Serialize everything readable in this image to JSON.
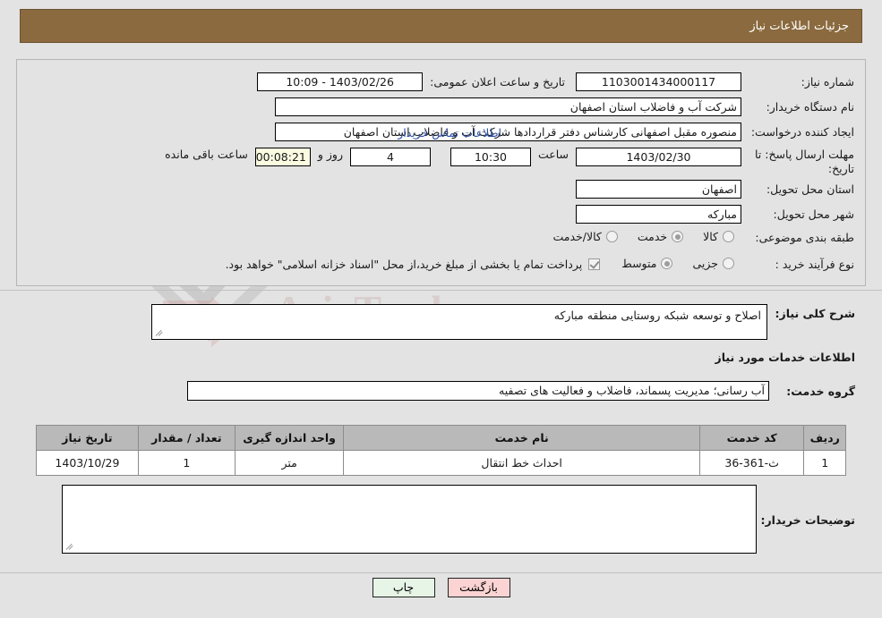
{
  "header": {
    "title": "جزئیات اطلاعات نیاز"
  },
  "top_panel": {
    "need_number_label": "شماره نیاز:",
    "need_number_value": "1103001434000117",
    "announce_label": "تاریخ و ساعت اعلان عمومی:",
    "announce_value": "1403/02/26 - 10:09",
    "buyer_label": "نام دستگاه خریدار:",
    "buyer_value": "شرکت آب و فاضلاب استان اصفهان",
    "creator_label": "ایجاد کننده درخواست:",
    "creator_value": "منصوره مقبل اصفهانی کارشناس دفتر قراردادها شرکت آب و فاضلاب استان اصفهان",
    "contact_link": "اطلاعات تماس خریدار",
    "deadline_label": "مهلت ارسال پاسخ: تا تاریخ:",
    "deadline_date": "1403/02/30",
    "hour_label": "ساعت",
    "deadline_time": "10:30",
    "days_value": "4",
    "days_label": "روز و",
    "remaining_value": "00:08:21",
    "remaining_label": "ساعت باقی مانده",
    "province_label": "استان محل تحویل:",
    "province_value": "اصفهان",
    "city_label": "شهر محل تحویل:",
    "city_value": "مبارکه",
    "category_label": "طبقه بندی موضوعی:",
    "category_options": [
      {
        "label": "کالا",
        "selected": false
      },
      {
        "label": "خدمت",
        "selected": true
      },
      {
        "label": "کالا/خدمت",
        "selected": false
      }
    ],
    "process_label": "نوع فرآیند خرید :",
    "process_options": [
      {
        "label": "جزیی",
        "selected": false
      },
      {
        "label": "متوسط",
        "selected": true
      }
    ],
    "payment_checked": true,
    "payment_note": "پرداخت تمام یا بخشی از مبلغ خرید،از محل \"اسناد خزانه اسلامی\" خواهد بود."
  },
  "mid_panel": {
    "summary_label": "شرح کلی نیاز:",
    "summary_value": "اصلاح و توسعه شبکه روستایی منطقه مبارکه",
    "services_heading": "اطلاعات خدمات مورد نیاز",
    "service_group_label": "گروه خدمت:",
    "service_group_value": "آب رسانی؛ مدیریت پسماند، فاضلاب و فعالیت های تصفیه"
  },
  "table": {
    "headers": [
      "ردیف",
      "کد خدمت",
      "نام خدمت",
      "واحد اندازه گیری",
      "تعداد / مقدار",
      "تاریخ نیاز"
    ],
    "rows": [
      {
        "row": "1",
        "code": "ث-361-36",
        "name": "احداث خط انتقال",
        "unit": "متر",
        "qty": "1",
        "date": "1403/10/29"
      }
    ]
  },
  "bottom": {
    "buyer_notes_label": "توضیحات خریدار:",
    "buyer_notes_value": "",
    "print_button": "چاپ",
    "back_button": "بازگشت"
  },
  "watermark": {
    "brand": "AriaTender.net",
    "top_brand": "AriaTender"
  }
}
